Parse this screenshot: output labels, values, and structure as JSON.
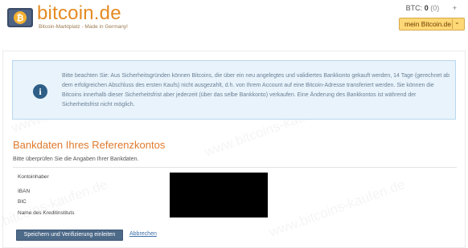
{
  "header": {
    "brand": "bitcoin.de",
    "tagline": "Bitcoin-Marktplatz - Made in Germany!",
    "logo_icon": "wallet-bitcoin-logo-icon",
    "btc_label": "BTC:",
    "btc_balance": "0",
    "btc_reserved": "(0)",
    "plus": "+",
    "account_button": "mein Bitcoin.de",
    "account_chevron": "⌄"
  },
  "info": {
    "icon": "info-icon",
    "icon_glyph": "i",
    "text": "Bitte beachten Sie: Aus Sicherheitsgründen können Bitcoins, die über ein neu angelegtes und validiertes Bankkonto gekauft werden, 14 Tage (gerechnet ab dem erfolgreichen Abschluss des ersten Kaufs) nicht ausgezahlt, d.h. von Ihrem Account auf eine Bitcoin-Adresse transferiert werden. Sie können die Bitcoins innerhalb dieser Sicherheitsfrist aber jederzeit (über das selbe Bankkonto) verkaufen. Eine Änderung des Bankkontos ist während der Sicherheitsfrist nicht möglich."
  },
  "bank": {
    "title": "Bankdaten Ihres Referenzkontos",
    "subtitle": "Bitte überprüfen Sie die Angaben Ihrer Bankdaten.",
    "labels": {
      "holder": "Kontoinhaber",
      "iban": "IBAN",
      "bic": "BIC",
      "bank_name": "Name des Kreditinstituts"
    }
  },
  "actions": {
    "submit": "Speichern und Verifizierung einleiten",
    "cancel": "Abbrechen"
  },
  "watermark": "www.bitcoins-kaufen.de",
  "colors": {
    "brand_orange": "#e58a22",
    "accent_button": "#ffd877",
    "primary_button": "#4d6a88",
    "info_background": "#e8f3fb",
    "info_icon": "#2e5e86",
    "title": "#e07a2e"
  }
}
